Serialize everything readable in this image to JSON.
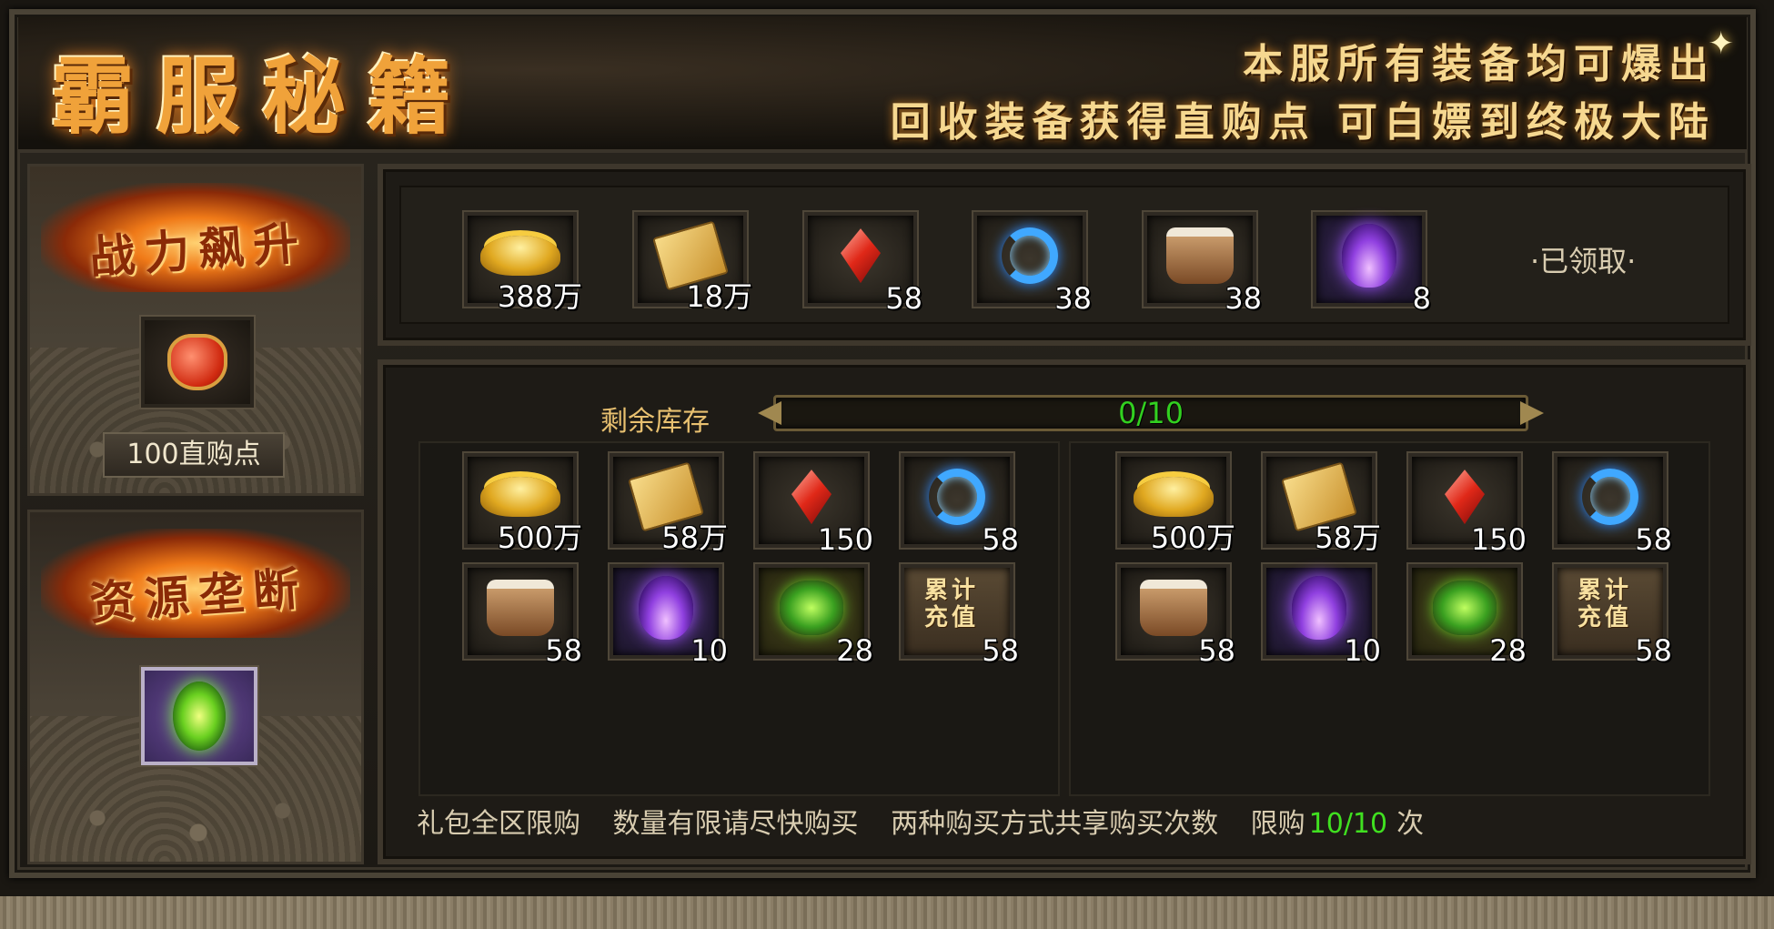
{
  "header": {
    "title": "霸服秘籍",
    "slogan_line1": "本服所有装备均可爆出",
    "slogan_line2": "回收装备获得直购点 可白嫖到终极大陆"
  },
  "left": {
    "card1": {
      "banner": "战力飙升",
      "icon": "red-pouch-icon",
      "price": "100直购点"
    },
    "card2": {
      "banner": "资源垄断",
      "icon": "green-dragon-icon"
    }
  },
  "reward_row": {
    "items": [
      {
        "icon": "gold-ingot-icon",
        "count": "388万"
      },
      {
        "icon": "ticket-icon",
        "count": "18万"
      },
      {
        "icon": "red-gem-icon",
        "count": "58"
      },
      {
        "icon": "blue-swirl-icon",
        "count": "38"
      },
      {
        "icon": "card-bag-icon",
        "count": "38"
      },
      {
        "icon": "purple-flame-icon",
        "count": "8"
      }
    ],
    "status": "·已领取·"
  },
  "stock": {
    "label": "剩余库存",
    "current": 0,
    "max": 10,
    "text": "0/10"
  },
  "gift_a": {
    "items": [
      {
        "icon": "gold-ingot-icon",
        "count": "500万"
      },
      {
        "icon": "ticket-icon",
        "count": "58万"
      },
      {
        "icon": "red-gem-icon",
        "count": "150"
      },
      {
        "icon": "blue-swirl-icon",
        "count": "58"
      },
      {
        "icon": "card-bag-icon",
        "count": "58"
      },
      {
        "icon": "purple-flame-icon",
        "count": "10"
      },
      {
        "icon": "green-mist-icon",
        "count": "28"
      },
      {
        "icon": "recharge-icon",
        "label": "累计充值",
        "count": "58"
      }
    ]
  },
  "gift_b": {
    "items": [
      {
        "icon": "gold-ingot-icon",
        "count": "500万"
      },
      {
        "icon": "ticket-icon",
        "count": "58万"
      },
      {
        "icon": "red-gem-icon",
        "count": "150"
      },
      {
        "icon": "blue-swirl-icon",
        "count": "58"
      },
      {
        "icon": "card-bag-icon",
        "count": "58"
      },
      {
        "icon": "purple-flame-icon",
        "count": "10"
      },
      {
        "icon": "green-mist-icon",
        "count": "28"
      },
      {
        "icon": "recharge-icon",
        "label": "累计充值",
        "count": "58"
      }
    ]
  },
  "footer": {
    "notice1": "礼包全区限购",
    "notice2": "数量有限请尽快购买",
    "notice3": "两种购买方式共享购买次数",
    "limit_prefix": "限购",
    "limit_value": "10/10",
    "limit_suffix": "次"
  },
  "colors": {
    "accent_gold": "#f0a23a",
    "progress_green": "#32d020",
    "limit_green": "#40e020"
  }
}
